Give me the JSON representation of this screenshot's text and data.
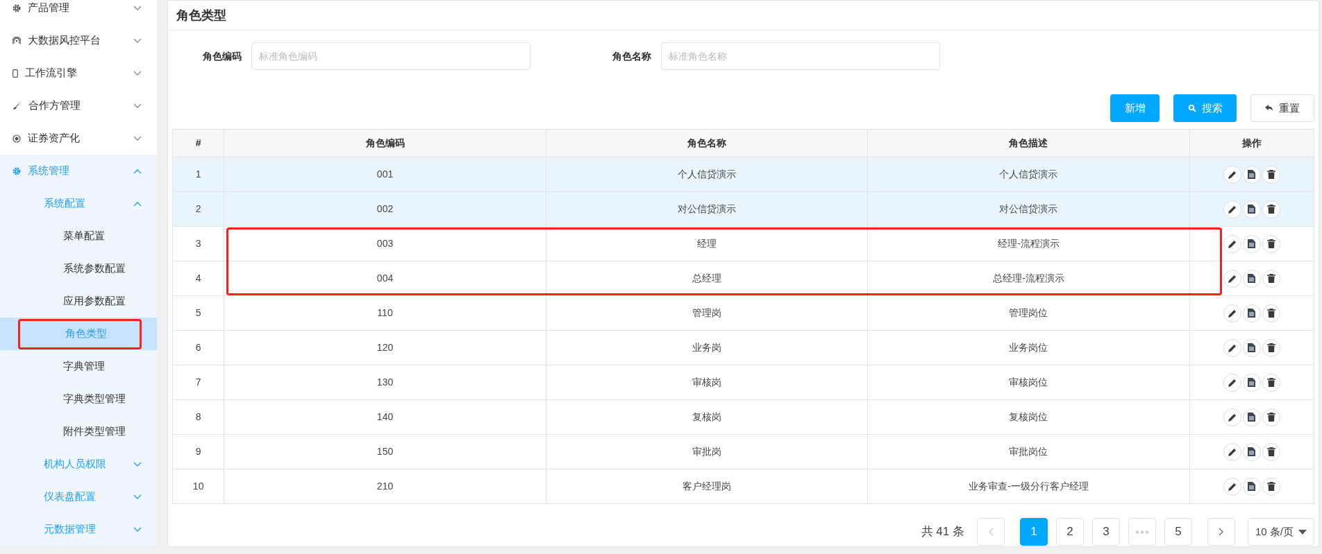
{
  "sidebar": {
    "items": [
      {
        "label": "产品管理",
        "expanded": false
      },
      {
        "label": "大数据风控平台",
        "expanded": false
      },
      {
        "label": "工作流引擎",
        "expanded": false
      },
      {
        "label": "合作方管理",
        "expanded": false
      },
      {
        "label": "证券资产化",
        "expanded": false
      },
      {
        "label": "系统管理",
        "expanded": true,
        "children": [
          {
            "label": "系统配置",
            "expanded": true,
            "children": [
              {
                "label": "菜单配置",
                "selected": false,
                "marked": false
              },
              {
                "label": "系统参数配置",
                "selected": false,
                "marked": false
              },
              {
                "label": "应用参数配置",
                "selected": false,
                "marked": false
              },
              {
                "label": "角色类型",
                "selected": true,
                "marked": true
              },
              {
                "label": "字典管理",
                "selected": false,
                "marked": false
              },
              {
                "label": "字典类型管理",
                "selected": false,
                "marked": false
              },
              {
                "label": "附件类型管理",
                "selected": false,
                "marked": false
              }
            ]
          },
          {
            "label": "机构人员权限",
            "expanded": false
          },
          {
            "label": "仪表盘配置",
            "expanded": false
          },
          {
            "label": "元数据管理",
            "expanded": false
          }
        ]
      }
    ]
  },
  "page": {
    "title": "角色类型"
  },
  "filters": [
    {
      "label": "角色编码",
      "placeholder": "标准角色编码"
    },
    {
      "label": "角色名称",
      "placeholder": "标准角色名称"
    }
  ],
  "buttons": [
    {
      "label": "新增",
      "kind": "primary"
    },
    {
      "label": "搜索",
      "kind": "search"
    },
    {
      "label": "重置",
      "kind": "reset"
    }
  ],
  "table": {
    "columns": [
      "#",
      "角色编码",
      "角色名称",
      "角色描述",
      "操作"
    ],
    "rows": [
      {
        "cells": [
          "1",
          "001",
          "个人信贷演示",
          "个人信贷演示"
        ],
        "selected": true,
        "marked": false
      },
      {
        "cells": [
          "2",
          "002",
          "对公信贷演示",
          "对公信贷演示"
        ],
        "selected": true,
        "marked": false
      },
      {
        "cells": [
          "3",
          "003",
          "经理",
          "经理-流程演示"
        ],
        "selected": false,
        "marked": true
      },
      {
        "cells": [
          "4",
          "004",
          "总经理",
          "总经理-流程演示"
        ],
        "selected": false,
        "marked": true
      },
      {
        "cells": [
          "5",
          "110",
          "管理岗",
          "管理岗位"
        ],
        "selected": false,
        "marked": false
      },
      {
        "cells": [
          "6",
          "120",
          "业务岗",
          "业务岗位"
        ],
        "selected": false,
        "marked": false
      },
      {
        "cells": [
          "7",
          "130",
          "审核岗",
          "审核岗位"
        ],
        "selected": false,
        "marked": false
      },
      {
        "cells": [
          "8",
          "140",
          "复核岗",
          "复核岗位"
        ],
        "selected": false,
        "marked": false
      },
      {
        "cells": [
          "9",
          "150",
          "审批岗",
          "审批岗位"
        ],
        "selected": false,
        "marked": false
      },
      {
        "cells": [
          "10",
          "210",
          "客户经理岗",
          "业务审查-一级分行客户经理"
        ],
        "selected": false,
        "marked": false
      }
    ]
  },
  "pagination": {
    "total": "共 41 条",
    "pages": [
      {
        "label": "1",
        "kind": "page",
        "selected": true
      },
      {
        "label": "2",
        "kind": "page",
        "selected": false
      },
      {
        "label": "3",
        "kind": "page",
        "selected": false
      },
      {
        "kind": "ellipsis"
      },
      {
        "label": "5",
        "kind": "page",
        "selected": false
      }
    ],
    "page_size": "10 条/页"
  }
}
